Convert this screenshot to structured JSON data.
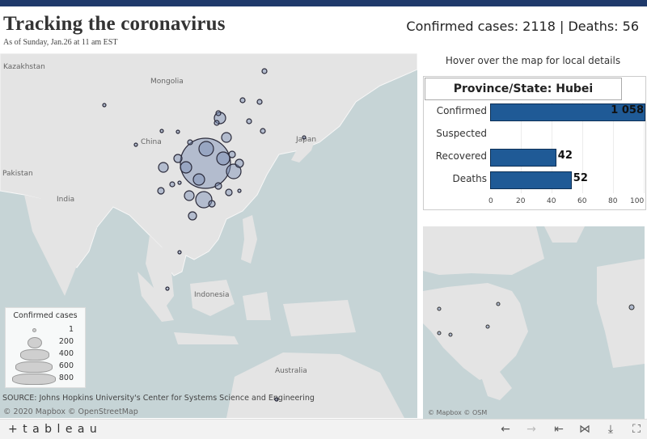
{
  "header": {
    "title": "Tracking the coronavirus",
    "subtitle": "As of Sunday, Jan.26 at 11 am EST",
    "headline": "Confirmed cases: 2118 | Deaths: 56"
  },
  "map": {
    "labels": {
      "kazakhstan": "Kazakhstan",
      "mongolia": "Mongolia",
      "china": "China",
      "japan": "Japan",
      "pakistan": "Pakistan",
      "india": "India",
      "indonesia": "Indonesia",
      "australia": "Australia"
    },
    "source": "SOURCE: Johns Hopkins University's Center for Systems Science and Engineering",
    "credit": "© 2020 Mapbox © OpenStreetMap",
    "legend": {
      "title": "Confirmed cases",
      "items": [
        "1",
        "200",
        "400",
        "600",
        "800"
      ]
    }
  },
  "details": {
    "hover_hint": "Hover over the map for local details",
    "province_label": "Province/State: Hubei",
    "metrics": [
      {
        "label": "Confirmed",
        "value": 1058,
        "display": "1 058"
      },
      {
        "label": "Suspected",
        "value": 0,
        "display": ""
      },
      {
        "label": "Recovered",
        "value": 42,
        "display": "42"
      },
      {
        "label": "Deaths",
        "value": 52,
        "display": "52"
      }
    ],
    "axis_ticks": [
      "0",
      "20",
      "40",
      "60",
      "80",
      "100"
    ],
    "bar_color": "#1f5a96"
  },
  "minimap": {
    "credit": "© Mapbox © OSM"
  },
  "footer": {
    "logo": "+ t a b l e a u",
    "buttons": [
      "back-icon",
      "forward-icon",
      "revert-icon",
      "share-icon",
      "download-icon",
      "fullscreen-icon"
    ]
  }
}
